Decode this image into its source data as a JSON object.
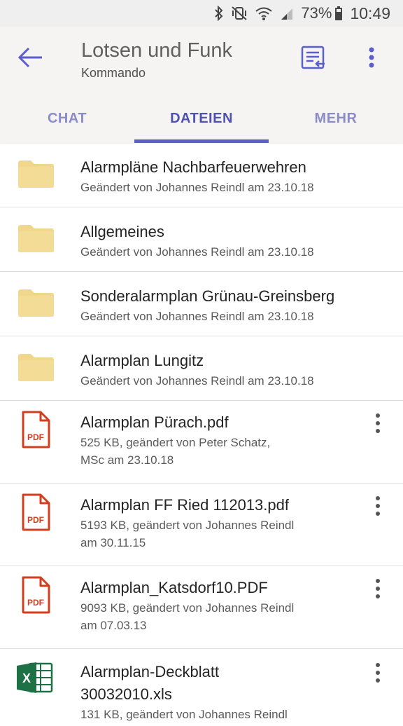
{
  "status_bar": {
    "battery_percent": "73%",
    "time": "10:49",
    "icons": [
      "bluetooth-icon",
      "vibrate-mute-icon",
      "wifi-icon",
      "signal-icon",
      "battery-icon"
    ]
  },
  "header": {
    "title": "Lotsen und Funk",
    "subtitle": "Kommando",
    "back_icon": "arrow-left-icon",
    "action_icons": [
      "channel-info-icon",
      "more-vertical-icon"
    ]
  },
  "tabs": [
    {
      "label": "CHAT",
      "active": false
    },
    {
      "label": "DATEIEN",
      "active": true
    },
    {
      "label": "MEHR",
      "active": false
    }
  ],
  "colors": {
    "accent": "#5b5fc7",
    "tab_inactive": "#8b8cc7",
    "folder": "#f0d78c",
    "pdf": "#d13f1f",
    "excel": "#1e7145"
  },
  "files": [
    {
      "type": "folder",
      "icon": "folder-icon",
      "name": "Alarmpläne Nachbarfeuerwehren",
      "meta_lines": [
        "Geändert von Johannes Reindl am 23.10.18"
      ]
    },
    {
      "type": "folder",
      "icon": "folder-icon",
      "name": "Allgemeines",
      "meta_lines": [
        "Geändert von Johannes Reindl am 23.10.18"
      ]
    },
    {
      "type": "folder",
      "icon": "folder-icon",
      "name": "Sonderalarmplan Grünau-Greinsberg",
      "meta_lines": [
        "Geändert von Johannes Reindl am 23.10.18"
      ]
    },
    {
      "type": "folder",
      "icon": "folder-icon",
      "name": "Alarmplan Lungitz",
      "meta_lines": [
        "Geändert von Johannes Reindl am 23.10.18"
      ]
    },
    {
      "type": "pdf",
      "icon": "pdf-file-icon",
      "icon_label": "PDF",
      "name": "Alarmplan Pürach.pdf",
      "meta_lines": [
        "525 KB, geändert von Peter Schatz,",
        "MSc am 23.10.18"
      ]
    },
    {
      "type": "pdf",
      "icon": "pdf-file-icon",
      "icon_label": "PDF",
      "name": "Alarmplan FF Ried 112013.pdf",
      "meta_lines": [
        "5193 KB, geändert von Johannes Reindl",
        "am 30.11.15"
      ]
    },
    {
      "type": "pdf",
      "icon": "pdf-file-icon",
      "icon_label": "PDF",
      "name": "Alarmplan_Katsdorf10.PDF",
      "meta_lines": [
        "9093 KB, geändert von Johannes Reindl",
        "am 07.03.13"
      ]
    },
    {
      "type": "xls",
      "icon": "excel-file-icon",
      "icon_label": "X",
      "name_lines": [
        "Alarmplan-Deckblatt",
        "30032010.xls"
      ],
      "meta_lines": [
        "131 KB, geändert von Johannes Reindl"
      ]
    }
  ]
}
